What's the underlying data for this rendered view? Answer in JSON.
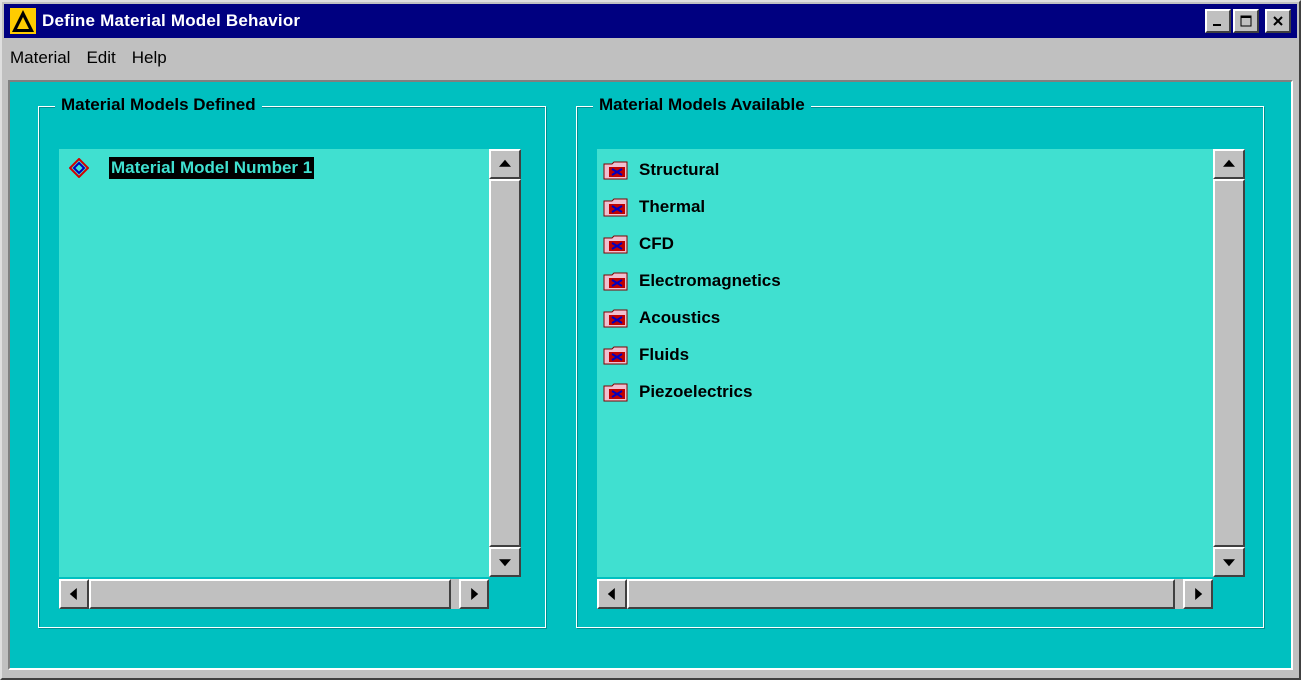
{
  "window": {
    "title": "Define Material Model Behavior",
    "controls": {
      "minimize": "_",
      "maximize": "□",
      "close": "×"
    }
  },
  "menubar": {
    "items": [
      {
        "label": "Material"
      },
      {
        "label": "Edit"
      },
      {
        "label": "Help"
      }
    ]
  },
  "defined_panel": {
    "title": "Material Models Defined",
    "items": [
      {
        "label": "Material Model Number 1",
        "selected": true,
        "icon": "diamond-icon"
      }
    ]
  },
  "available_panel": {
    "title": "Material Models Available",
    "items": [
      {
        "label": "Structural",
        "icon": "folder-icon"
      },
      {
        "label": "Thermal",
        "icon": "folder-icon"
      },
      {
        "label": "CFD",
        "icon": "folder-icon"
      },
      {
        "label": "Electromagnetics",
        "icon": "folder-icon"
      },
      {
        "label": "Acoustics",
        "icon": "folder-icon"
      },
      {
        "label": "Fluids",
        "icon": "folder-icon"
      },
      {
        "label": "Piezoelectrics",
        "icon": "folder-icon"
      }
    ]
  },
  "colors": {
    "titlebar": "#000080",
    "client_background": "#00c0c0",
    "list_background": "#40e0d0",
    "selection_background": "#000000"
  }
}
